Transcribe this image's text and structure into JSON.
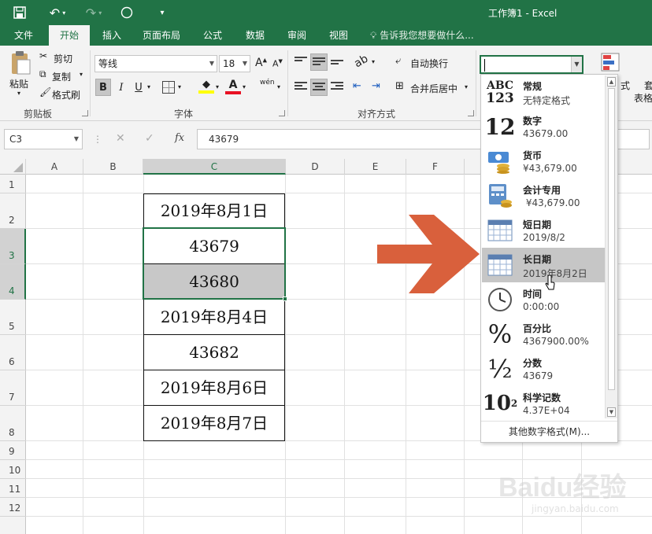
{
  "window": {
    "title": "工作簿1 - Excel"
  },
  "tabs": [
    {
      "label": "文件"
    },
    {
      "label": "开始",
      "active": true
    },
    {
      "label": "插入"
    },
    {
      "label": "页面布局"
    },
    {
      "label": "公式"
    },
    {
      "label": "数据"
    },
    {
      "label": "审阅"
    },
    {
      "label": "视图"
    }
  ],
  "tell_me": "告诉我您想要做什么...",
  "ribbon": {
    "clipboard": {
      "paste": "粘贴",
      "cut": "剪切",
      "copy": "复制",
      "format_painter": "格式刷",
      "group": "剪贴板"
    },
    "font": {
      "name": "等线",
      "size": "18",
      "bold": "B",
      "italic": "I",
      "underline": "U",
      "wen": "wén",
      "group": "字体"
    },
    "alignment": {
      "wrap": "自动换行",
      "merge": "合并后居中",
      "group": "对齐方式"
    },
    "number": {
      "format_value": ""
    },
    "styles": {
      "cond_partial": "式",
      "table_partial": "套",
      "table_partial2": "表格"
    }
  },
  "formula_bar": {
    "name_box": "C3",
    "fx": "fx",
    "value": "43679"
  },
  "colors": {
    "excel_green": "#217346",
    "arrow": "#d9603c"
  },
  "columns": [
    "A",
    "B",
    "C",
    "D",
    "E",
    "F"
  ],
  "rows": [
    "1",
    "2",
    "3",
    "4",
    "5",
    "6",
    "7",
    "8",
    "9",
    "10",
    "11",
    "12"
  ],
  "cells": {
    "C2": "2019年8月1日",
    "C3": "43679",
    "C4": "43680",
    "C5": "2019年8月4日",
    "C6": "43682",
    "C7": "2019年8月6日",
    "C8": "2019年8月7日"
  },
  "number_formats": [
    {
      "name": "常规",
      "sample": "无特定格式",
      "icon": "abc-123-icon",
      "icon_text": "ABC\n123"
    },
    {
      "name": "数字",
      "sample": "43679.00",
      "icon": "number-12-icon",
      "icon_text": "12"
    },
    {
      "name": "货币",
      "sample": "¥43,679.00",
      "icon": "currency-icon"
    },
    {
      "name": "会计专用",
      "sample": " ¥43,679.00",
      "icon": "accounting-icon"
    },
    {
      "name": "短日期",
      "sample": "2019/8/2",
      "icon": "calendar-icon"
    },
    {
      "name": "长日期",
      "sample": "2019年8月2日",
      "icon": "calendar-icon",
      "hover": true
    },
    {
      "name": "时间",
      "sample": "0:00:00",
      "icon": "clock-icon"
    },
    {
      "name": "百分比",
      "sample": "4367900.00%",
      "icon": "percent-icon",
      "icon_text": "%"
    },
    {
      "name": "分数",
      "sample": "43679",
      "icon": "fraction-icon",
      "icon_text": "½"
    },
    {
      "name": "科学记数",
      "sample": "4.37E+04",
      "icon": "scientific-icon",
      "icon_text": "10²"
    }
  ],
  "more_formats": "其他数字格式(M)...",
  "watermark": {
    "brand": "Baidu经验",
    "sub": "jingyan.baidu.com"
  }
}
